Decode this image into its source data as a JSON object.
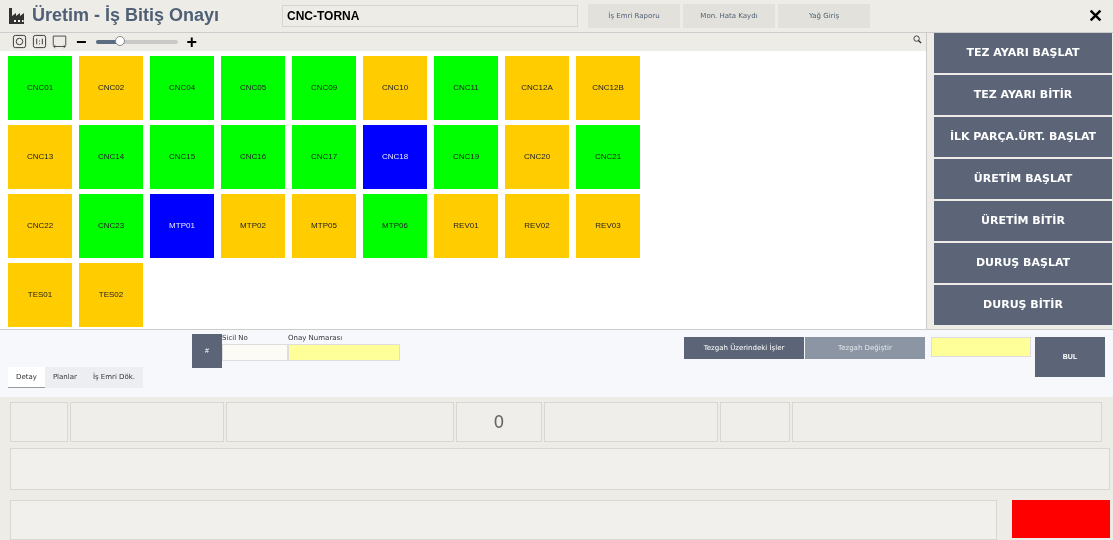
{
  "header": {
    "title": "Üretim - İş Bitiş Onayı",
    "workcenter": "CNC-TORNA",
    "links": [
      "İş Emri Raporu",
      "Mon. Hata Kaydı",
      "Yağ Giriş"
    ],
    "close": "✕"
  },
  "toolbar": {
    "minus": "−",
    "plus": "+",
    "zoom": {
      "level": 0.3
    }
  },
  "machines": [
    {
      "label": "CNC01",
      "color": "#00ff00"
    },
    {
      "label": "CNC02",
      "color": "#ffcc00"
    },
    {
      "label": "CNC04",
      "color": "#00ff00"
    },
    {
      "label": "CNC05",
      "color": "#00ff00"
    },
    {
      "label": "CNC09",
      "color": "#00ff00"
    },
    {
      "label": "CNC10",
      "color": "#ffcc00"
    },
    {
      "label": "CNC11",
      "color": "#00ff00"
    },
    {
      "label": "CNC12A",
      "color": "#ffcc00"
    },
    {
      "label": "CNC12B",
      "color": "#ffcc00"
    },
    {
      "label": "CNC13",
      "color": "#ffcc00"
    },
    {
      "label": "CNC14",
      "color": "#00ff00"
    },
    {
      "label": "CNC15",
      "color": "#00ff00"
    },
    {
      "label": "CNC16",
      "color": "#00ff00"
    },
    {
      "label": "CNC17",
      "color": "#00ff00"
    },
    {
      "label": "CNC18",
      "color": "#0000ff"
    },
    {
      "label": "CNC19",
      "color": "#00ff00"
    },
    {
      "label": "CNC20",
      "color": "#ffcc00"
    },
    {
      "label": "CNC21",
      "color": "#00ff00"
    },
    {
      "label": "CNC22",
      "color": "#ffcc00"
    },
    {
      "label": "CNC23",
      "color": "#00ff00"
    },
    {
      "label": "MTP01",
      "color": "#0000ff"
    },
    {
      "label": "MTP02",
      "color": "#ffcc00"
    },
    {
      "label": "MTP05",
      "color": "#ffcc00"
    },
    {
      "label": "MTP06",
      "color": "#00ff00"
    },
    {
      "label": "REV01",
      "color": "#ffcc00"
    },
    {
      "label": "REV02",
      "color": "#ffcc00"
    },
    {
      "label": "REV03",
      "color": "#ffcc00"
    },
    {
      "label": "TES01",
      "color": "#ffcc00"
    },
    {
      "label": "TES02",
      "color": "#ffcc00"
    }
  ],
  "actions": [
    "TEZ AYARI BAŞLAT",
    "TEZ AYARI BİTİR",
    "İLK PARÇA.ÜRT. BAŞLAT",
    "ÜRETİM BAŞLAT",
    "ÜRETİM BİTİR",
    "DURUŞ BAŞLAT",
    "DURUŞ BİTİR"
  ],
  "form": {
    "hash": "#",
    "sicil_label": "Sicil No",
    "onay_label": "Onay Numarası",
    "jobs_button": {
      "label": "Tezgah Üzerindeki İşler",
      "disabled": false
    },
    "change_button": {
      "label": "Tezgah Değiştir",
      "disabled": true
    },
    "find": "BUL"
  },
  "tabs": [
    {
      "label": "Detay",
      "selected": true
    },
    {
      "label": "Planlar",
      "selected": false
    },
    {
      "label": "İş Emri Dök.",
      "selected": false
    }
  ],
  "summary": {
    "cells": [
      "",
      "",
      "",
      "0",
      "",
      "",
      ""
    ]
  }
}
